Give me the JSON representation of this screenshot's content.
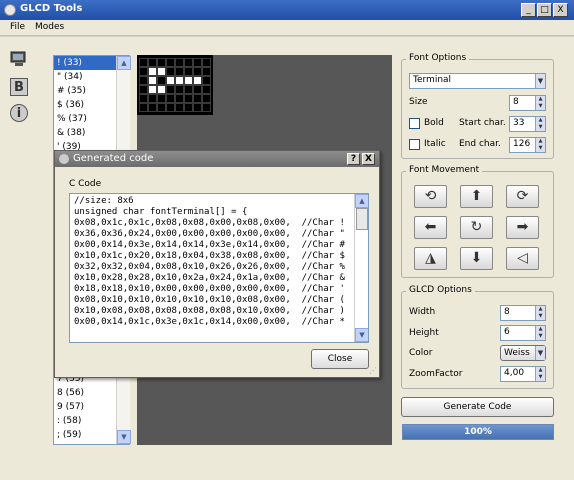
{
  "window": {
    "title": "GLCD Tools",
    "buttons": {
      "minimize": "_",
      "maximize": "□",
      "close": "X"
    }
  },
  "menubar": {
    "items": [
      "File",
      "Modes"
    ]
  },
  "sidebar": {
    "icons": [
      "display-icon",
      "bold-icon",
      "info-icon"
    ],
    "bold_glyph": "B",
    "info_glyph": "i"
  },
  "charlist": {
    "top_items": [
      "! (33)",
      "\" (34)",
      "# (35)",
      "$ (36)",
      "% (37)",
      "& (38)",
      "' (39)"
    ],
    "bottom_items": [
      "7 (55)",
      "8 (56)",
      "9 (57)",
      ": (58)",
      "; (59)"
    ],
    "selected_index": 0
  },
  "preview": {
    "rows": 6,
    "cols": 8,
    "on_cells": [
      [
        1,
        1
      ],
      [
        2,
        1
      ],
      [
        1,
        2
      ],
      [
        3,
        2
      ],
      [
        4,
        2
      ],
      [
        5,
        2
      ],
      [
        6,
        2
      ],
      [
        1,
        3
      ],
      [
        2,
        3
      ]
    ]
  },
  "font_options": {
    "title": "Font Options",
    "font": "Terminal",
    "size_label": "Size",
    "size": "8",
    "bold_label": "Bold",
    "italic_label": "Italic",
    "start_label": "Start char.",
    "start_value": "33",
    "end_label": "End char.",
    "end_value": "126"
  },
  "font_movement": {
    "title": "Font Movement"
  },
  "glcd_options": {
    "title": "GLCD Options",
    "width_label": "Width",
    "width": "8",
    "height_label": "Height",
    "height": "6",
    "color_label": "Color",
    "color": "Weiss",
    "zoom_label": "ZoomFactor",
    "zoom": "4,00"
  },
  "generate_button": "Generate Code",
  "progress": {
    "text": "100%",
    "value": 1.0
  },
  "dialog": {
    "title": "Generated code",
    "help": "?",
    "close_x": "X",
    "section_label": "C Code",
    "code_lines": [
      "//size: 8x6",
      "unsigned char fontTerminal[] = {",
      "0x08,0x1c,0x1c,0x08,0x08,0x00,0x08,0x00,  //Char !",
      "0x36,0x36,0x24,0x00,0x00,0x00,0x00,0x00,  //Char \"",
      "0x00,0x14,0x3e,0x14,0x14,0x3e,0x14,0x00,  //Char #",
      "0x10,0x1c,0x20,0x18,0x04,0x38,0x08,0x00,  //Char $",
      "0x32,0x32,0x04,0x08,0x10,0x26,0x26,0x00,  //Char %",
      "0x10,0x28,0x28,0x10,0x2a,0x24,0x1a,0x00,  //Char &",
      "0x18,0x18,0x10,0x00,0x00,0x00,0x00,0x00,  //Char '",
      "0x08,0x10,0x10,0x10,0x10,0x10,0x08,0x00,  //Char (",
      "0x10,0x08,0x08,0x08,0x08,0x08,0x10,0x00,  //Char )",
      "0x00,0x14,0x1c,0x3e,0x1c,0x14,0x00,0x00,  //Char *"
    ],
    "close_button": "Close"
  },
  "colors": {
    "titlebar": "#1f4fa6",
    "selection": "#316ac5",
    "canvas": "#575757",
    "progress": "#4572b3"
  }
}
